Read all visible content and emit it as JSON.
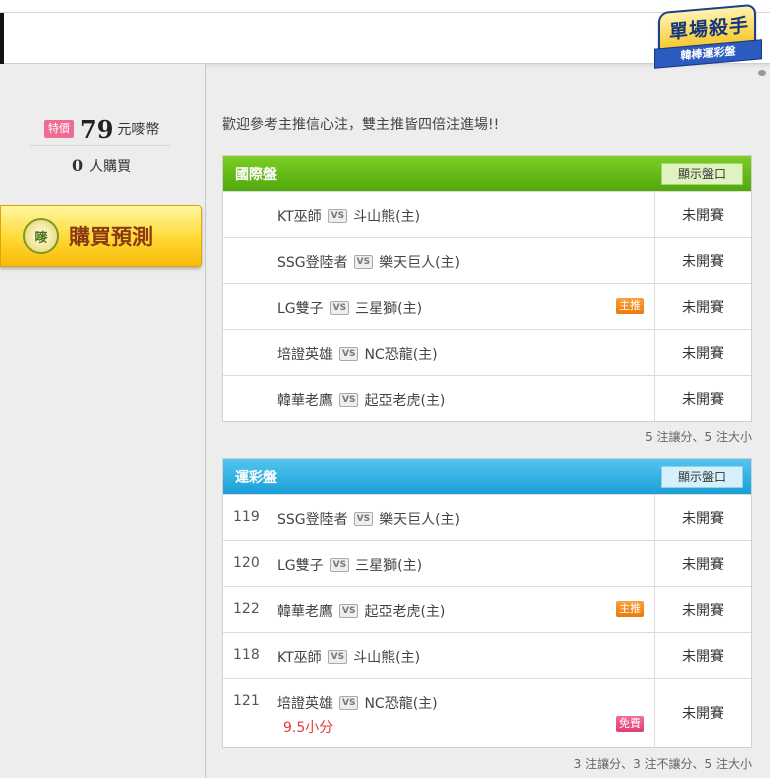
{
  "logo": {
    "title": "單場殺手",
    "subtitle": "韓棒運彩盤"
  },
  "sidebar": {
    "special_tag": "特價",
    "price": "79",
    "price_unit": "元嘜幣",
    "buyers_count": "0",
    "buyers_label": "人購買",
    "buy_icon_char": "嘜",
    "buy_button_label": "購買預測"
  },
  "welcome_text": "歡迎參考主推信心注，雙主推皆四倍注進場!!",
  "vs_label": "VS",
  "panels": [
    {
      "title": "國際盤",
      "show_button": "顯示盤口",
      "rows": [
        {
          "away": "KT巫師",
          "home": "斗山熊(主)",
          "status": "未開賽"
        },
        {
          "away": "SSG登陸者",
          "home": "樂天巨人(主)",
          "status": "未開賽"
        },
        {
          "away": "LG雙子",
          "home": "三星獅(主)",
          "tag": "主推",
          "status": "未開賽"
        },
        {
          "away": "培證英雄",
          "home": "NC恐龍(主)",
          "status": "未開賽"
        },
        {
          "away": "韓華老鷹",
          "home": "起亞老虎(主)",
          "status": "未開賽"
        }
      ],
      "footer": "5 注讓分、5 注大小"
    },
    {
      "title": "運彩盤",
      "show_button": "顯示盤口",
      "rows": [
        {
          "num": "119",
          "away": "SSG登陸者",
          "home": "樂天巨人(主)",
          "status": "未開賽"
        },
        {
          "num": "120",
          "away": "LG雙子",
          "home": "三星獅(主)",
          "status": "未開賽"
        },
        {
          "num": "122",
          "away": "韓華老鷹",
          "home": "起亞老虎(主)",
          "tag": "主推",
          "status": "未開賽"
        },
        {
          "num": "118",
          "away": "KT巫師",
          "home": "斗山熊(主)",
          "status": "未開賽"
        },
        {
          "num": "121",
          "away": "培證英雄",
          "home": "NC恐龍(主)",
          "sub": "9.5小分",
          "tag": "免費",
          "status": "未開賽"
        }
      ],
      "footer": "3 注讓分、3 注不讓分、5 注大小"
    }
  ],
  "colors": {
    "intl_header": "#5fb516",
    "sport_header": "#2eb0e4",
    "tag_main": "#f08a1c",
    "tag_free": "#e8477e",
    "sub_value": "#e03a3a",
    "buy_button": "#ffd52b"
  }
}
